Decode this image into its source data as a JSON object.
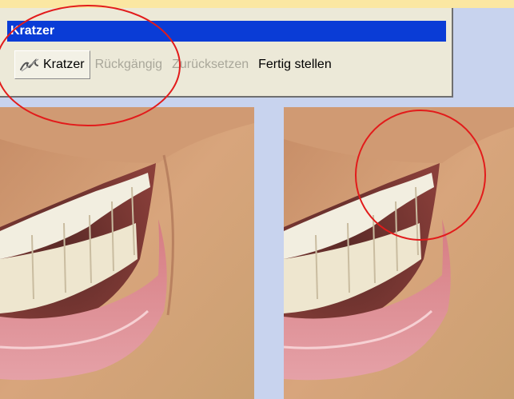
{
  "panel": {
    "title": "Kratzer"
  },
  "toolbar": {
    "items": [
      {
        "label": "Kratzer",
        "icon": "scratch-brush-icon",
        "state": "active"
      },
      {
        "label": "Rückgängig",
        "state": "disabled"
      },
      {
        "label": "Zurücksetzen",
        "state": "disabled"
      },
      {
        "label": "Fertig stellen",
        "state": "enabled"
      }
    ]
  },
  "images": {
    "left": {
      "description_visible": false
    },
    "right": {
      "description_visible": false
    }
  },
  "colors": {
    "title_bar": "#0a3cd6",
    "panel_bg": "#ece9d8",
    "page_bg": "#c8d3ee",
    "top_strip": "#fbe7a2",
    "annotation_ring": "#e21b1b"
  }
}
